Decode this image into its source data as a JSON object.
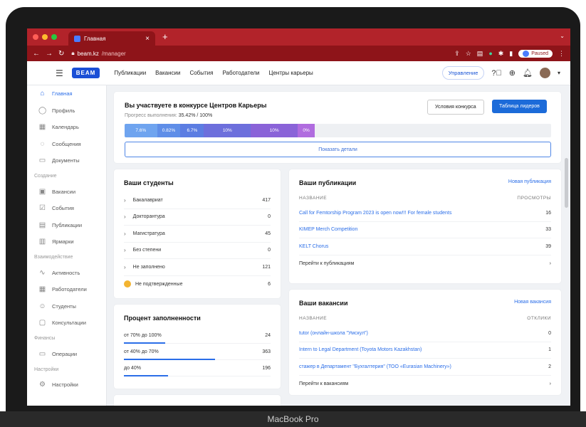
{
  "browser": {
    "tab_title": "Главная",
    "url_host": "beam.kz",
    "url_path": "/manager",
    "profile_label": "Paused"
  },
  "header": {
    "logo": "BEAM",
    "nav": [
      "Публикации",
      "Вакансии",
      "События",
      "Работодатели",
      "Центры карьеры"
    ],
    "manage_button": "Управление"
  },
  "sidebar": {
    "items": [
      {
        "label": "Главная",
        "icon": "home-icon",
        "active": true
      },
      {
        "label": "Профиль",
        "icon": "profile-icon"
      },
      {
        "label": "Календарь",
        "icon": "calendar-icon"
      },
      {
        "label": "Сообщения",
        "icon": "message-icon"
      },
      {
        "label": "Документы",
        "icon": "folder-icon"
      }
    ],
    "section_create": "Создание",
    "create_items": [
      {
        "label": "Вакансии",
        "icon": "briefcase-icon"
      },
      {
        "label": "События",
        "icon": "event-icon"
      },
      {
        "label": "Публикации",
        "icon": "publication-icon"
      },
      {
        "label": "Ярмарки",
        "icon": "fair-icon"
      }
    ],
    "section_interaction": "Взаимодействие",
    "interaction_items": [
      {
        "label": "Активность",
        "icon": "activity-icon"
      },
      {
        "label": "Работодатели",
        "icon": "building-icon"
      },
      {
        "label": "Студенты",
        "icon": "students-icon"
      },
      {
        "label": "Консультации",
        "icon": "consult-icon"
      }
    ],
    "section_finance": "Финансы",
    "finance_items": [
      {
        "label": "Операции",
        "icon": "operations-icon"
      }
    ],
    "section_settings": "Настройки",
    "settings_items": [
      {
        "label": "Настройки",
        "icon": "gear-icon"
      }
    ]
  },
  "contest": {
    "title": "Вы участвуете в конкурсе Центров Карьеры",
    "terms_button": "Условия конкурса",
    "leaders_button": "Таблица лидеров",
    "progress_label": "Прогресс выполнения:",
    "progress_value": "35.42% / 100%",
    "segments": [
      {
        "label": "7.6%",
        "value": 7.6,
        "color": "#6fa4ef"
      },
      {
        "label": "0.82%",
        "value": 5.5,
        "color": "#5f8ee8"
      },
      {
        "label": "6.7%",
        "value": 5.5,
        "color": "#5c7de2"
      },
      {
        "label": "10%",
        "value": 11,
        "color": "#6d6fdc"
      },
      {
        "label": "10%",
        "value": 11,
        "color": "#8a63d8"
      },
      {
        "label": "0%",
        "value": 4,
        "color": "#b06cdf"
      }
    ],
    "details_button": "Показать детали"
  },
  "students": {
    "title": "Ваши студенты",
    "rows": [
      {
        "label": "Бакалавриат",
        "value": "417"
      },
      {
        "label": "Докторантура",
        "value": "0"
      },
      {
        "label": "Магистратура",
        "value": "45"
      },
      {
        "label": "Без степени",
        "value": "0"
      },
      {
        "label": "Не заполнено",
        "value": "121"
      }
    ],
    "unconfirmed_label": "Не подтвержденные",
    "unconfirmed_value": "6"
  },
  "fill": {
    "title": "Процент заполненности",
    "rows": [
      {
        "label": "от 70% до 100%",
        "value": "24",
        "fill": 0.28
      },
      {
        "label": "от 40% до 70%",
        "value": "363",
        "fill": 0.62
      },
      {
        "label": "до 40%",
        "value": "196",
        "fill": 0.3
      }
    ]
  },
  "publications": {
    "title": "Ваши публикации",
    "new_link": "Новая публикация",
    "col_name": "НАЗВАНИЕ",
    "col_views": "ПРОСМОТРЫ",
    "rows": [
      {
        "name": "Call for Femtorship Program 2023 is open now!!! For female students",
        "value": "16"
      },
      {
        "name": "KIMEP Merch Competition",
        "value": "33"
      },
      {
        "name": "KELT Chorus",
        "value": "39"
      }
    ],
    "goto": "Перейти к публикациям"
  },
  "vacancies": {
    "title": "Ваши вакансии",
    "new_link": "Новая вакансия",
    "col_name": "НАЗВАНИЕ",
    "col_responses": "ОТКЛИКИ",
    "rows": [
      {
        "name": "tutor (онлайн-школа \"Умскул\")",
        "value": "0"
      },
      {
        "name": "Intern to Legal Department (Toyota Motors Kazakhstan)",
        "value": "1"
      },
      {
        "name": "стажер в Департамент \"Бухгалтерия\" (ТОО «Eurasian Machinery»)",
        "value": "2"
      }
    ],
    "goto": "Перейти к вакансиям"
  },
  "device_label": "MacBook Pro"
}
